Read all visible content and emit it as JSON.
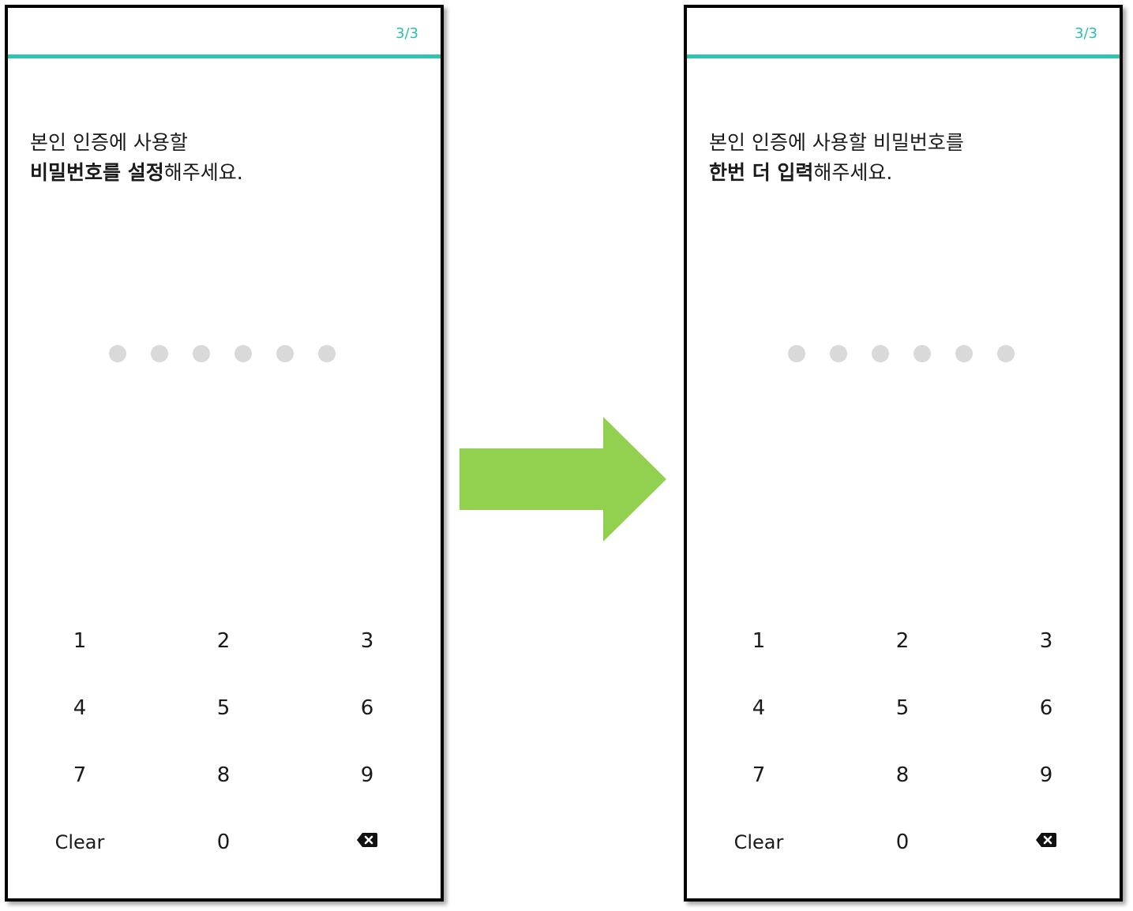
{
  "colors": {
    "accent": "#2ec4b0",
    "dot_empty": "#d9d9d9",
    "arrow": "#92d050"
  },
  "screens": [
    {
      "progress": "3/3",
      "line1": "본인 인증에 사용할",
      "line2_bold": "비밀번호를 설정",
      "line2_rest": "해주세요.",
      "pin_dots_filled": 0,
      "pin_dots_total": 6,
      "keys": [
        "1",
        "2",
        "3",
        "4",
        "5",
        "6",
        "7",
        "8",
        "9",
        "Clear",
        "0"
      ],
      "backspace_icon": "backspace-icon"
    },
    {
      "progress": "3/3",
      "line1": "본인 인증에 사용할 비밀번호를",
      "line2_bold": "한번 더 입력",
      "line2_rest": "해주세요.",
      "pin_dots_filled": 0,
      "pin_dots_total": 6,
      "keys": [
        "1",
        "2",
        "3",
        "4",
        "5",
        "6",
        "7",
        "8",
        "9",
        "Clear",
        "0"
      ],
      "backspace_icon": "backspace-icon"
    }
  ],
  "transition_icon": "right-arrow-icon"
}
